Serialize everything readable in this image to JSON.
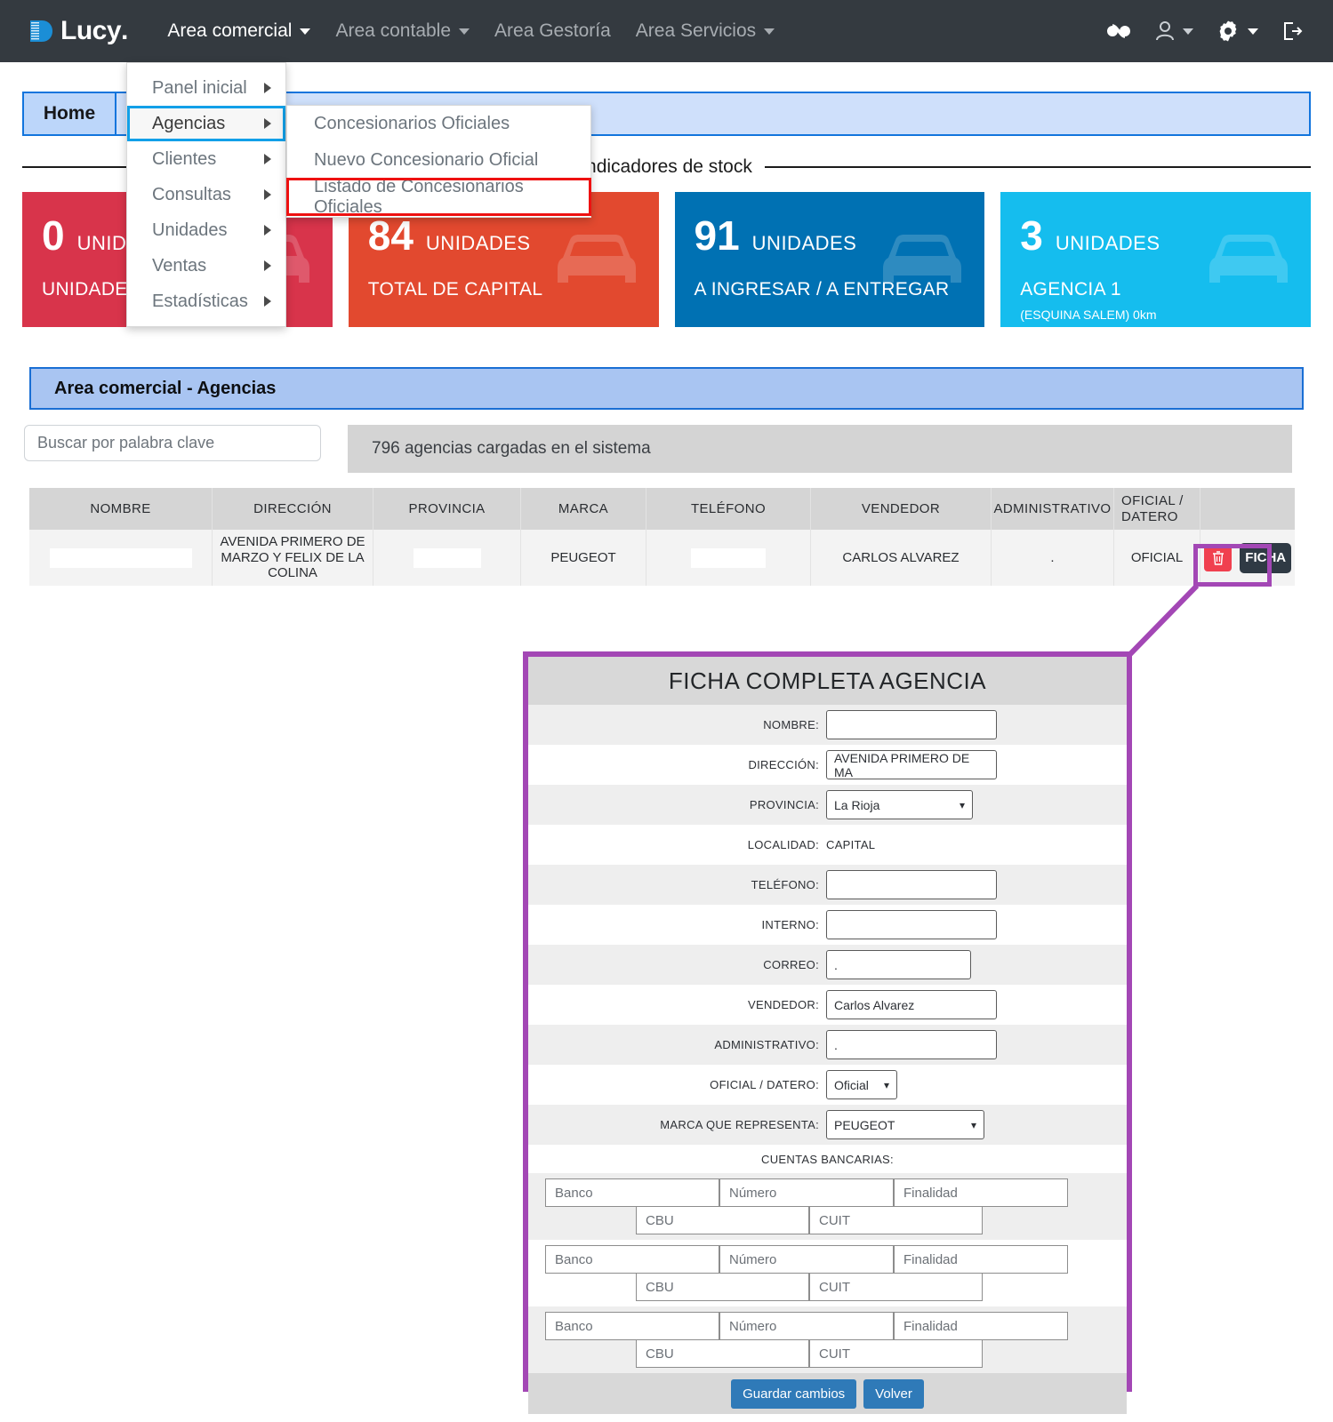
{
  "navbar": {
    "brand": "Lucy",
    "brand_suffix": ".",
    "items": [
      {
        "label": "Area comercial",
        "has_caret": true,
        "active": true
      },
      {
        "label": "Area contable",
        "has_caret": true,
        "active": false
      },
      {
        "label": "Area Gestoría",
        "has_caret": false,
        "active": false
      },
      {
        "label": "Area Servicios",
        "has_caret": true,
        "active": false
      }
    ],
    "right_icons": [
      {
        "name": "infinity-icon",
        "glyph": "∞",
        "caret": false
      },
      {
        "name": "user-icon",
        "glyph": "person",
        "caret": true
      },
      {
        "name": "gear-icon",
        "glyph": "gear",
        "caret": true
      },
      {
        "name": "logout-icon",
        "glyph": "logout",
        "caret": false
      }
    ]
  },
  "dropdown": {
    "items": [
      {
        "label": "Panel inicial",
        "highlighted": false
      },
      {
        "label": "Agencias",
        "highlighted": true
      },
      {
        "label": "Clientes",
        "highlighted": false
      },
      {
        "label": "Consultas",
        "highlighted": false
      },
      {
        "label": "Unidades",
        "highlighted": false
      },
      {
        "label": "Ventas",
        "highlighted": false
      },
      {
        "label": "Estadísticas",
        "highlighted": false
      }
    ]
  },
  "submenu": {
    "items": [
      {
        "label": "Concesionarios Oficiales",
        "boxed": false
      },
      {
        "label": "Nuevo Concesionario Oficial",
        "boxed": false
      },
      {
        "label": "Listado de Concesionarios Oficiales",
        "boxed": true
      }
    ]
  },
  "tabs": {
    "home_label": "Home"
  },
  "section": {
    "title": "Indicadores de stock"
  },
  "cards": [
    {
      "number": "0",
      "unit": "UNIDADES",
      "subtitle": "UNIDADES A PEDIR",
      "extra": "",
      "color": "#d8344b"
    },
    {
      "number": "84",
      "unit": "UNIDADES",
      "subtitle": "TOTAL DE CAPITAL",
      "extra": "",
      "color": "#e2492f"
    },
    {
      "number": "91",
      "unit": "UNIDADES",
      "subtitle": "A INGRESAR / A ENTREGAR",
      "extra": "",
      "color": "#0071b3"
    },
    {
      "number": "3",
      "unit": "UNIDADES",
      "subtitle": "AGENCIA 1",
      "extra": "(ESQUINA SALEM) 0km",
      "color": "#15bdee"
    }
  ],
  "panel": {
    "title": "Area comercial - Agencias"
  },
  "search": {
    "placeholder": "Buscar por palabra clave",
    "value": ""
  },
  "count_bar": {
    "text": "796 agencias cargadas en el sistema"
  },
  "table": {
    "headers": [
      "NOMBRE",
      "DIRECCIÓN",
      "PROVINCIA",
      "MARCA",
      "TELÉFONO",
      "VENDEDOR",
      "ADMINISTRATIVO",
      "OFICIAL / DATERO",
      ""
    ],
    "rows": [
      {
        "nombre": "",
        "direccion": "AVENIDA PRIMERO DE MARZO Y FELIX DE LA COLINA",
        "provincia": "",
        "marca": "PEUGEOT",
        "telefono": "",
        "vendedor": "CARLOS ALVAREZ",
        "administrativo": ".",
        "oficial_datero": "OFICIAL",
        "delete_label": "",
        "ficha_label": "FICHA"
      }
    ]
  },
  "ficha": {
    "title": "FICHA COMPLETA AGENCIA",
    "fields": [
      {
        "label": "NOMBRE:",
        "type": "input",
        "value": "",
        "width": "w-lg"
      },
      {
        "label": "DIRECCIÓN:",
        "type": "input",
        "value": "AVENIDA PRIMERO DE MA",
        "width": "w-lg"
      },
      {
        "label": "PROVINCIA:",
        "type": "select",
        "value": "La Rioja",
        "width": "w-prov"
      },
      {
        "label": "LOCALIDAD:",
        "type": "text",
        "value": "CAPITAL",
        "width": ""
      },
      {
        "label": "TELÉFONO:",
        "type": "input",
        "value": "",
        "width": "w-lg"
      },
      {
        "label": "INTERNO:",
        "type": "input",
        "value": "",
        "width": "w-lg"
      },
      {
        "label": "CORREO:",
        "type": "input",
        "value": ".",
        "width": "w-md"
      },
      {
        "label": "VENDEDOR:",
        "type": "input",
        "value": "Carlos Alvarez",
        "width": "w-lg"
      },
      {
        "label": "ADMINISTRATIVO:",
        "type": "input",
        "value": ".",
        "width": "w-lg"
      },
      {
        "label": "OFICIAL / DATERO:",
        "type": "select",
        "value": "Oficial",
        "width": "w-sm"
      },
      {
        "label": "MARCA QUE REPRESENTA:",
        "type": "select",
        "value": "PEUGEOT",
        "width": "w-marca"
      }
    ],
    "bank_section_label": "CUENTAS BANCARIAS:",
    "bank_accounts": [
      {
        "banco": "Banco",
        "numero": "Número",
        "finalidad": "Finalidad",
        "cbu": "CBU",
        "cuit": "CUIT"
      },
      {
        "banco": "Banco",
        "numero": "Número",
        "finalidad": "Finalidad",
        "cbu": "CBU",
        "cuit": "CUIT"
      },
      {
        "banco": "Banco",
        "numero": "Número",
        "finalidad": "Finalidad",
        "cbu": "CBU",
        "cuit": "CUIT"
      }
    ],
    "save_label": "Guardar cambios",
    "back_label": "Volver"
  },
  "colors": {
    "navbar_bg": "#343a40",
    "highlight_blue": "#12a0e8",
    "highlight_red": "#ee1111",
    "callout_purple": "#a347b5",
    "btn_blue": "#2f7ab8",
    "delete_red": "#f0404f",
    "ficha_dark": "#2f3a44"
  }
}
